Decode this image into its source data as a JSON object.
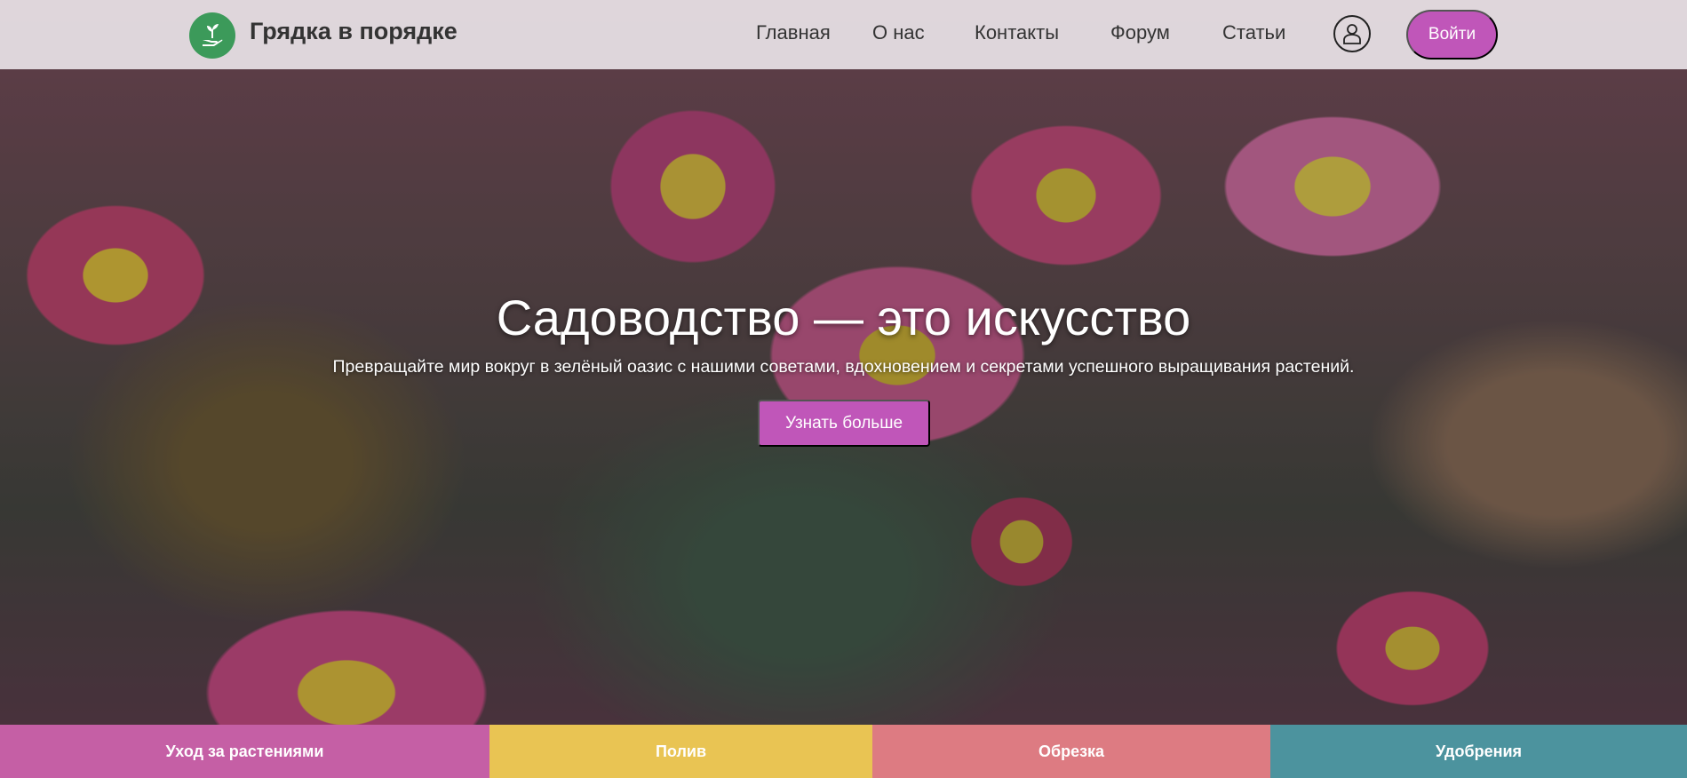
{
  "header": {
    "brand": "Грядка в порядке",
    "nav": [
      "Главная",
      "О нас",
      "Контакты",
      "Форум",
      "Статьи"
    ],
    "login_label": "Войти"
  },
  "hero": {
    "title": "Садоводство — это искусство",
    "subtitle": "Превращайте мир вокруг в зелёный оазис с нашими советами, вдохновением и секретами успешного выращивания растений.",
    "cta_label": "Узнать больше"
  },
  "categories": [
    {
      "label": "Уход за растениями",
      "color": "#c55fa5"
    },
    {
      "label": "Полив",
      "color": "#e9c453"
    },
    {
      "label": "Обрезка",
      "color": "#dd7b82"
    },
    {
      "label": "Удобрения",
      "color": "#4c939e"
    }
  ],
  "colors": {
    "accent": "#c056b9",
    "logo_bg": "#3c9a5a"
  },
  "icons": {
    "logo": "plant-hand-icon",
    "user": "user-icon"
  }
}
